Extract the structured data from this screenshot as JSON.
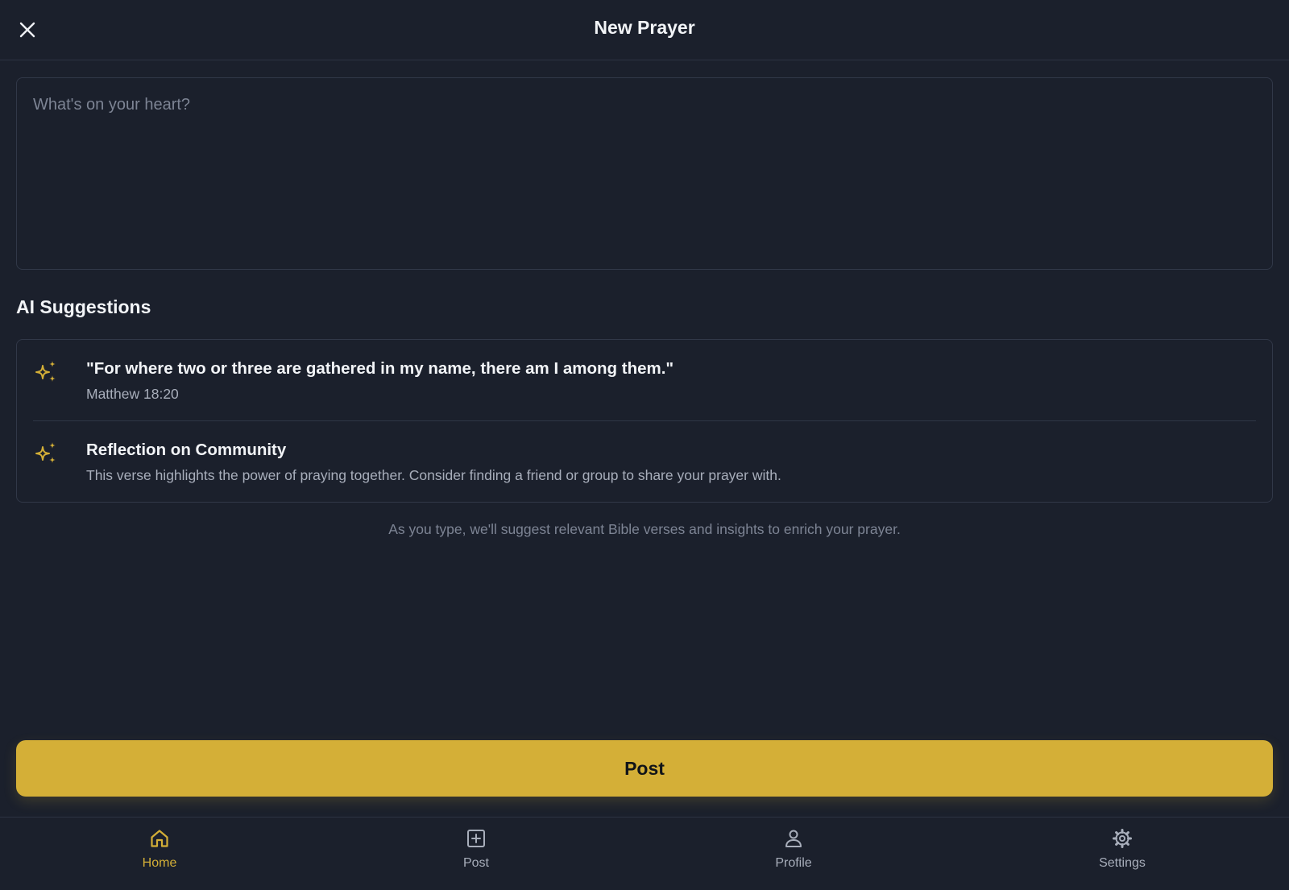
{
  "header": {
    "title": "New Prayer",
    "close_icon": "close-icon"
  },
  "compose": {
    "placeholder": "What's on your heart?",
    "value": ""
  },
  "suggestions": {
    "title": "AI Suggestions",
    "items": [
      {
        "icon": "sparkle-icon",
        "title": "\"For where two or three are gathered in my name, there am I among them.\"",
        "subtitle": "Matthew 18:20"
      },
      {
        "icon": "sparkle-icon",
        "title": "Reflection on Community",
        "subtitle": "This verse highlights the power of praying together. Consider finding a friend or group to share your prayer with."
      }
    ],
    "hint": "As you type, we'll suggest relevant Bible verses and insights to enrich your prayer."
  },
  "actions": {
    "post_label": "Post"
  },
  "tabbar": {
    "tabs": [
      {
        "label": "Home",
        "icon": "home-icon",
        "active": true
      },
      {
        "label": "Post",
        "icon": "plus-square-icon",
        "active": false
      },
      {
        "label": "Profile",
        "icon": "user-icon",
        "active": false
      },
      {
        "label": "Settings",
        "icon": "gear-icon",
        "active": false
      }
    ]
  },
  "colors": {
    "background": "#1b202c",
    "accent": "#d4af37",
    "text_primary": "#f2f4f7",
    "text_secondary": "#a8aebb",
    "text_muted": "#7d8494",
    "border": "#313848"
  }
}
